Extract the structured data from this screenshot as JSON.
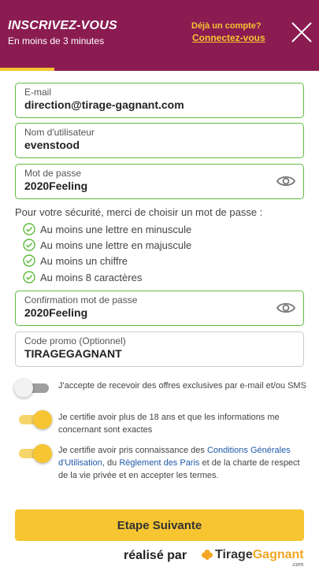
{
  "header": {
    "title": "INSCRIVEZ-VOUS",
    "subtitle": "En moins de 3 minutes",
    "have_account": "Déjà un compte?",
    "login_link": "Connectez-vous",
    "progress_fraction": 0.17
  },
  "form": {
    "email": {
      "label": "E-mail",
      "value": "direction@tirage-gagnant.com"
    },
    "username": {
      "label": "Nom d'utilisateur",
      "value": "evenstood"
    },
    "password": {
      "label": "Mot de passe",
      "value": "2020Feeling"
    },
    "security_intro": "Pour votre sécurité, merci de choisir un mot de passe :",
    "rules": [
      "Au moins une lettre en minuscule",
      "Au moins une lettre en majuscule",
      "Au moins un chiffre",
      "Au moins 8 caractères"
    ],
    "password_confirm": {
      "label": "Confirmation mot de passe",
      "value": "2020Feeling"
    },
    "promo": {
      "label": "Code promo (Optionnel)",
      "value": "TIRAGEGAGNANT"
    }
  },
  "consents": {
    "offers": {
      "text": "J'accepte de recevoir des offres exclusives par e-mail et/ou SMS",
      "checked": false
    },
    "age": {
      "text": "Je certifie avoir plus de 18 ans et que les informations me concernant sont exactes",
      "checked": true
    },
    "terms": {
      "checked": true,
      "part1": "Je certifie avoir pris connaissance des ",
      "link1": "Conditions Générales d'Utilisation",
      "part2": ", du ",
      "link2": "Règlement des Paris",
      "part3": " et de la charte de respect de la vie privée et en accepter les termes."
    }
  },
  "next_button": "Etape Suivante",
  "footer": {
    "made_by": "réalisé par",
    "logo_part1": "Tirage",
    "logo_part2": "Gagnant",
    "logo_suffix": ".com"
  },
  "colors": {
    "header_bg": "#8b1c52",
    "accent_yellow": "#f6c531",
    "valid_green": "#5fbb3e",
    "link_blue": "#1f5aa8"
  }
}
